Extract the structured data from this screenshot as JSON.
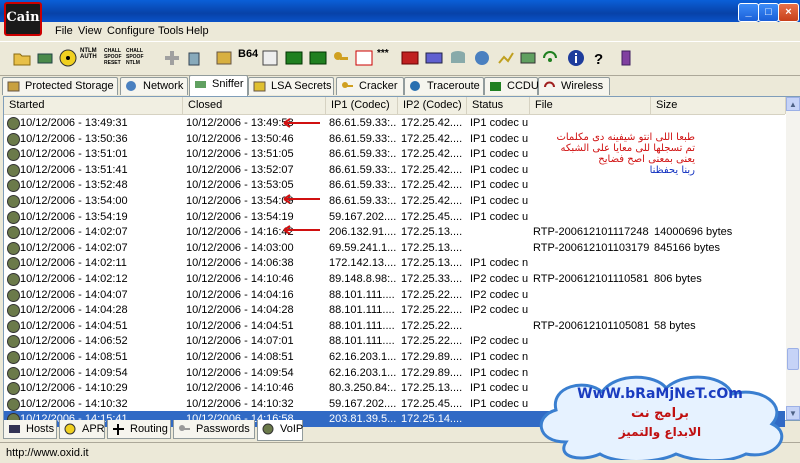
{
  "window": {
    "app_icon_text": "Cain",
    "min_glyph": "_",
    "max_glyph": "□",
    "close_glyph": "×"
  },
  "menu": [
    "File",
    "View",
    "Configure",
    "Tools",
    "Help"
  ],
  "toolbar_labels": {
    "nt_hash": "NTLM\nAUTH",
    "chall_spoof_reset": "CHALL\nSPOOF\nRESET",
    "chall_spoof_ntlm": "CHALL\nSPOOF\nNTLM",
    "b64": "B64",
    "stars": "***"
  },
  "tabs": [
    "Protected Storage",
    "Network",
    "Sniffer",
    "LSA Secrets",
    "Cracker",
    "Traceroute",
    "CCDU",
    "Wireless"
  ],
  "active_tab": "Sniffer",
  "columns": [
    "Started",
    "Closed",
    "IP1 (Codec)",
    "IP2 (Codec)",
    "Status",
    "File",
    "Size"
  ],
  "rows": [
    {
      "started": "10/12/2006 - 13:49:31",
      "closed": "10/12/2006 - 13:49:58",
      "ip1": "86.61.59.33:...",
      "ip2": "172.25.42....",
      "status": "IP1 codec u...",
      "file": "",
      "size": ""
    },
    {
      "started": "10/12/2006 - 13:50:36",
      "closed": "10/12/2006 - 13:50:46",
      "ip1": "86.61.59.33:...",
      "ip2": "172.25.42....",
      "status": "IP1 codec u...",
      "file": "",
      "size": ""
    },
    {
      "started": "10/12/2006 - 13:51:01",
      "closed": "10/12/2006 - 13:51:05",
      "ip1": "86.61.59.33:...",
      "ip2": "172.25.42....",
      "status": "IP1 codec u...",
      "file": "",
      "size": ""
    },
    {
      "started": "10/12/2006 - 13:51:41",
      "closed": "10/12/2006 - 13:52:07",
      "ip1": "86.61.59.33:...",
      "ip2": "172.25.42....",
      "status": "IP1 codec u...",
      "file": "",
      "size": ""
    },
    {
      "started": "10/12/2006 - 13:52:48",
      "closed": "10/12/2006 - 13:53:05",
      "ip1": "86.61.59.33:...",
      "ip2": "172.25.42....",
      "status": "IP1 codec u...",
      "file": "",
      "size": ""
    },
    {
      "started": "10/12/2006 - 13:54:00",
      "closed": "10/12/2006 - 13:54:09",
      "ip1": "86.61.59.33:...",
      "ip2": "172.25.42....",
      "status": "IP1 codec u...",
      "file": "",
      "size": ""
    },
    {
      "started": "10/12/2006 - 13:54:19",
      "closed": "10/12/2006 - 13:54:19",
      "ip1": "59.167.202....",
      "ip2": "172.25.45....",
      "status": "IP1 codec u...",
      "file": "",
      "size": ""
    },
    {
      "started": "10/12/2006 - 14:02:07",
      "closed": "10/12/2006 - 14:16:42",
      "ip1": "206.132.91....",
      "ip2": "172.25.13....",
      "status": "",
      "file": "RTP-2006121011172484...",
      "size": "14000696 bytes"
    },
    {
      "started": "10/12/2006 - 14:02:07",
      "closed": "10/12/2006 - 14:03:00",
      "ip1": "69.59.241.1...",
      "ip2": "172.25.13....",
      "status": "",
      "file": "RTP-2006121011031798...",
      "size": "845166 bytes"
    },
    {
      "started": "10/12/2006 - 14:02:11",
      "closed": "10/12/2006 - 14:06:38",
      "ip1": "172.142.13....",
      "ip2": "172.25.13....",
      "status": "IP1 codec n...",
      "file": "",
      "size": ""
    },
    {
      "started": "10/12/2006 - 14:02:12",
      "closed": "10/12/2006 - 14:10:46",
      "ip1": "89.148.8.98:...",
      "ip2": "172.25.33....",
      "status": "IP2 codec u...",
      "file": "RTP-2006121011105817...",
      "size": "806 bytes"
    },
    {
      "started": "10/12/2006 - 14:04:07",
      "closed": "10/12/2006 - 14:04:16",
      "ip1": "88.101.111....",
      "ip2": "172.25.22....",
      "status": "IP2 codec u...",
      "file": "",
      "size": ""
    },
    {
      "started": "10/12/2006 - 14:04:28",
      "closed": "10/12/2006 - 14:04:28",
      "ip1": "88.101.111....",
      "ip2": "172.25.22....",
      "status": "IP2 codec u...",
      "file": "",
      "size": ""
    },
    {
      "started": "10/12/2006 - 14:04:51",
      "closed": "10/12/2006 - 14:04:51",
      "ip1": "88.101.111....",
      "ip2": "172.25.22....",
      "status": "",
      "file": "RTP-2006121011050815...",
      "size": "58 bytes"
    },
    {
      "started": "10/12/2006 - 14:06:52",
      "closed": "10/12/2006 - 14:07:01",
      "ip1": "88.101.111....",
      "ip2": "172.25.22....",
      "status": "IP2 codec u...",
      "file": "",
      "size": ""
    },
    {
      "started": "10/12/2006 - 14:08:51",
      "closed": "10/12/2006 - 14:08:51",
      "ip1": "62.16.203.1...",
      "ip2": "172.29.89....",
      "status": "IP1 codec n...",
      "file": "",
      "size": ""
    },
    {
      "started": "10/12/2006 - 14:09:54",
      "closed": "10/12/2006 - 14:09:54",
      "ip1": "62.16.203.1...",
      "ip2": "172.29.89....",
      "status": "IP1 codec n...",
      "file": "",
      "size": ""
    },
    {
      "started": "10/12/2006 - 14:10:29",
      "closed": "10/12/2006 - 14:10:46",
      "ip1": "80.3.250.84:...",
      "ip2": "172.25.13....",
      "status": "IP1 codec u...",
      "file": "",
      "size": ""
    },
    {
      "started": "10/12/2006 - 14:10:32",
      "closed": "10/12/2006 - 14:10:32",
      "ip1": "59.167.202....",
      "ip2": "172.25.45....",
      "status": "IP1 codec u...",
      "file": "",
      "size": ""
    },
    {
      "started": "10/12/2006 - 14:15:41",
      "closed": "10/12/2006 - 14:16:58",
      "ip1": "203.81.39.5...",
      "ip2": "172.25.14....",
      "status": "",
      "file": "",
      "size": ""
    }
  ],
  "selected_row": 19,
  "bottom_tabs": [
    "Hosts",
    "APR",
    "Routing",
    "Passwords",
    "VoIP"
  ],
  "active_bottom_tab": "VoIP",
  "status_bar": "http://www.oxid.it",
  "annotation_lines": [
    "طبعا اللى انتو شيفينه دى مكلمات",
    "تم تسجلها للى معايا على الشبكه",
    "يعنى بمعنى اصح فضايح",
    "ربنا يحفظنا"
  ],
  "watermark": {
    "line1": "WwW.bRaMjNeT.cOm",
    "line2": "برامج نت",
    "line3": "الابداع والتميز"
  },
  "colors": {
    "selection": "#316ac5",
    "accent_red": "#d01010",
    "xp_blue": "#0a5fd8"
  }
}
